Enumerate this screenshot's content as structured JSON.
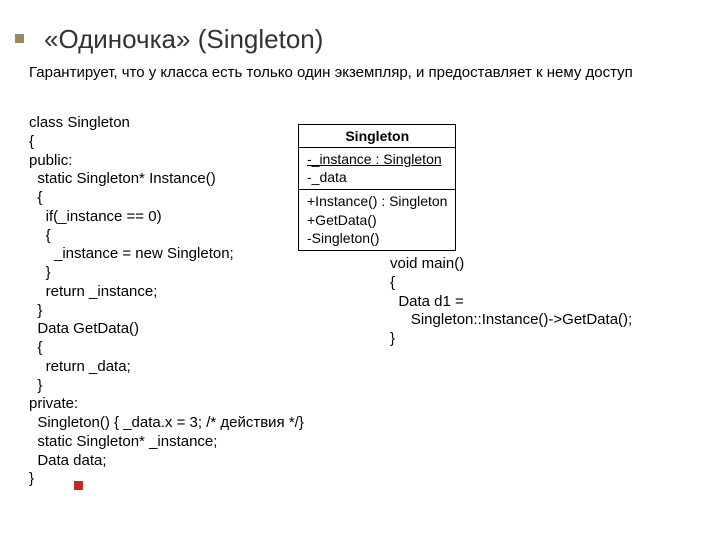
{
  "title": "«Одиночка» (Singleton)",
  "subtitle": "Гарантирует, что у класса есть только один экземпляр, и предоставляет к нему доступ",
  "code_left": "class Singleton\n{\npublic:\n  static Singleton* Instance()\n  {\n    if(_instance == 0)\n    {\n      _instance = new Singleton;\n    }\n    return _instance;\n  }\n  Data GetData()\n  {\n    return _data;\n  }\nprivate:\n  Singleton() { _data.x = 3; /* действия */}\n  static Singleton* _instance;\n  Data data;\n}",
  "code_right": "void main()\n{\n  Data d1 = \n     Singleton::Instance()->GetData();\n}",
  "uml": {
    "name": "Singleton",
    "attrs": [
      {
        "text": "-_instance : Singleton",
        "underline": true
      },
      {
        "text": "-_data",
        "underline": false
      }
    ],
    "ops": [
      "+Instance() : Singleton",
      "+GetData()",
      "-Singleton()"
    ]
  }
}
